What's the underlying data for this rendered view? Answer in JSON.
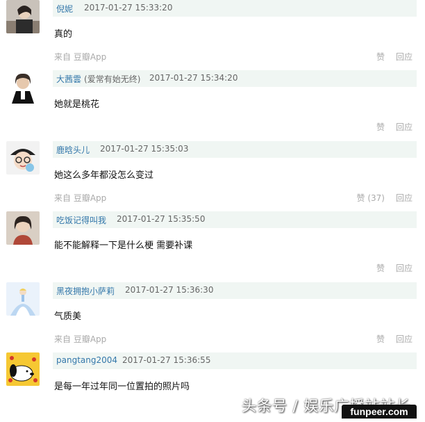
{
  "comments": [
    {
      "username": "倪妮",
      "note": "",
      "time": "2017-01-27 15:33:20",
      "content": "真的",
      "source": "来自 豆瓣App",
      "like": "赞",
      "reply": "回应"
    },
    {
      "username": "大茜雲",
      "note": "(爱常有始无终)",
      "time": "2017-01-27 15:34:20",
      "content": "她就是桃花",
      "source": "",
      "like": "赞",
      "reply": "回应"
    },
    {
      "username": "鹿晗头儿",
      "note": "",
      "time": "2017-01-27 15:35:03",
      "content": "她这么多年都没怎么变过",
      "source": "来自 豆瓣App",
      "like": "赞 (37)",
      "reply": "回应"
    },
    {
      "username": "吃饭记得叫我",
      "note": "",
      "time": "2017-01-27 15:35:50",
      "content": "能不能解释一下是什么梗 需要补课",
      "source": "",
      "like": "赞",
      "reply": "回应"
    },
    {
      "username": "黑夜拥抱小萨莉",
      "note": "",
      "time": "2017-01-27 15:36:30",
      "content": "气质美",
      "source": "来自 豆瓣App",
      "like": "赞",
      "reply": "回应"
    },
    {
      "username": "pangtang2004",
      "note": "",
      "time": "2017-01-27 15:36:55",
      "content": "是每一年过年同一位置拍的照片吗",
      "source": "",
      "like": "",
      "reply": ""
    }
  ],
  "watermark": {
    "text": "头条号 / 娱乐广播站站长",
    "badge": "funpeer.com"
  },
  "colors": {
    "username": "#3377aa",
    "header_bg": "#f0f6f3",
    "muted": "#aaaaaa"
  }
}
